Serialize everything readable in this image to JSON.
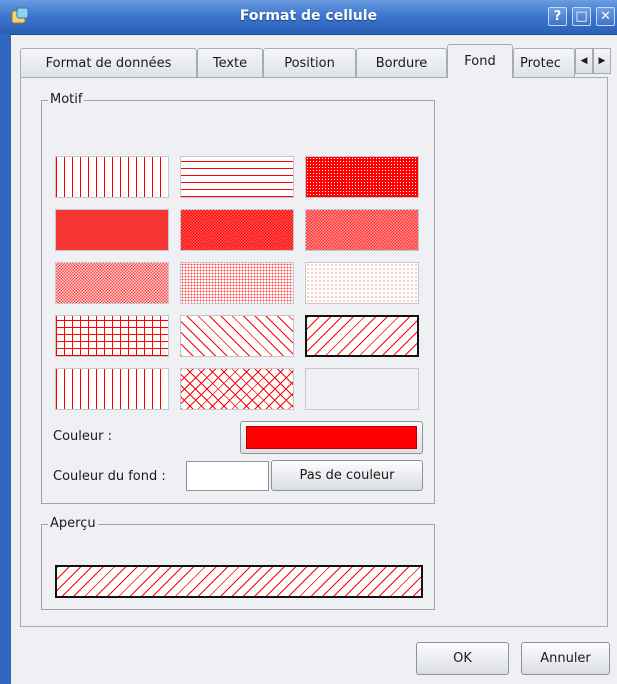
{
  "window": {
    "title": "Format de cellule",
    "help_button": "?",
    "max_button": "□",
    "close_button": "✕"
  },
  "tabs": [
    {
      "label": "Format de données"
    },
    {
      "label": "Texte"
    },
    {
      "label": "Position"
    },
    {
      "label": "Bordure"
    },
    {
      "label": "Fond"
    },
    {
      "label": "Protec"
    }
  ],
  "tab_scroll": {
    "left": "◀",
    "right": "▶"
  },
  "motif": {
    "group_label": "Motif",
    "patterns": [
      "vertical-lines",
      "horizontal-lines",
      "solid-90",
      "dense-80",
      "checker-70",
      "checker-60",
      "dot-50",
      "dot-30",
      "dot-15",
      "grid",
      "backward-diagonal",
      "forward-diagonal-selected",
      "vertical-lines-2",
      "diagonal-cross",
      "no-pattern"
    ],
    "pattern_color_hex": "#ff0000",
    "couleur_label": "Couleur :",
    "couleur_fond_label": "Couleur du fond :",
    "couleur_fond_value": "",
    "pas_de_couleur_button": "Pas de couleur"
  },
  "apercu": {
    "group_label": "Aperçu"
  },
  "footer": {
    "ok_button": "OK",
    "cancel_button": "Annuler"
  }
}
